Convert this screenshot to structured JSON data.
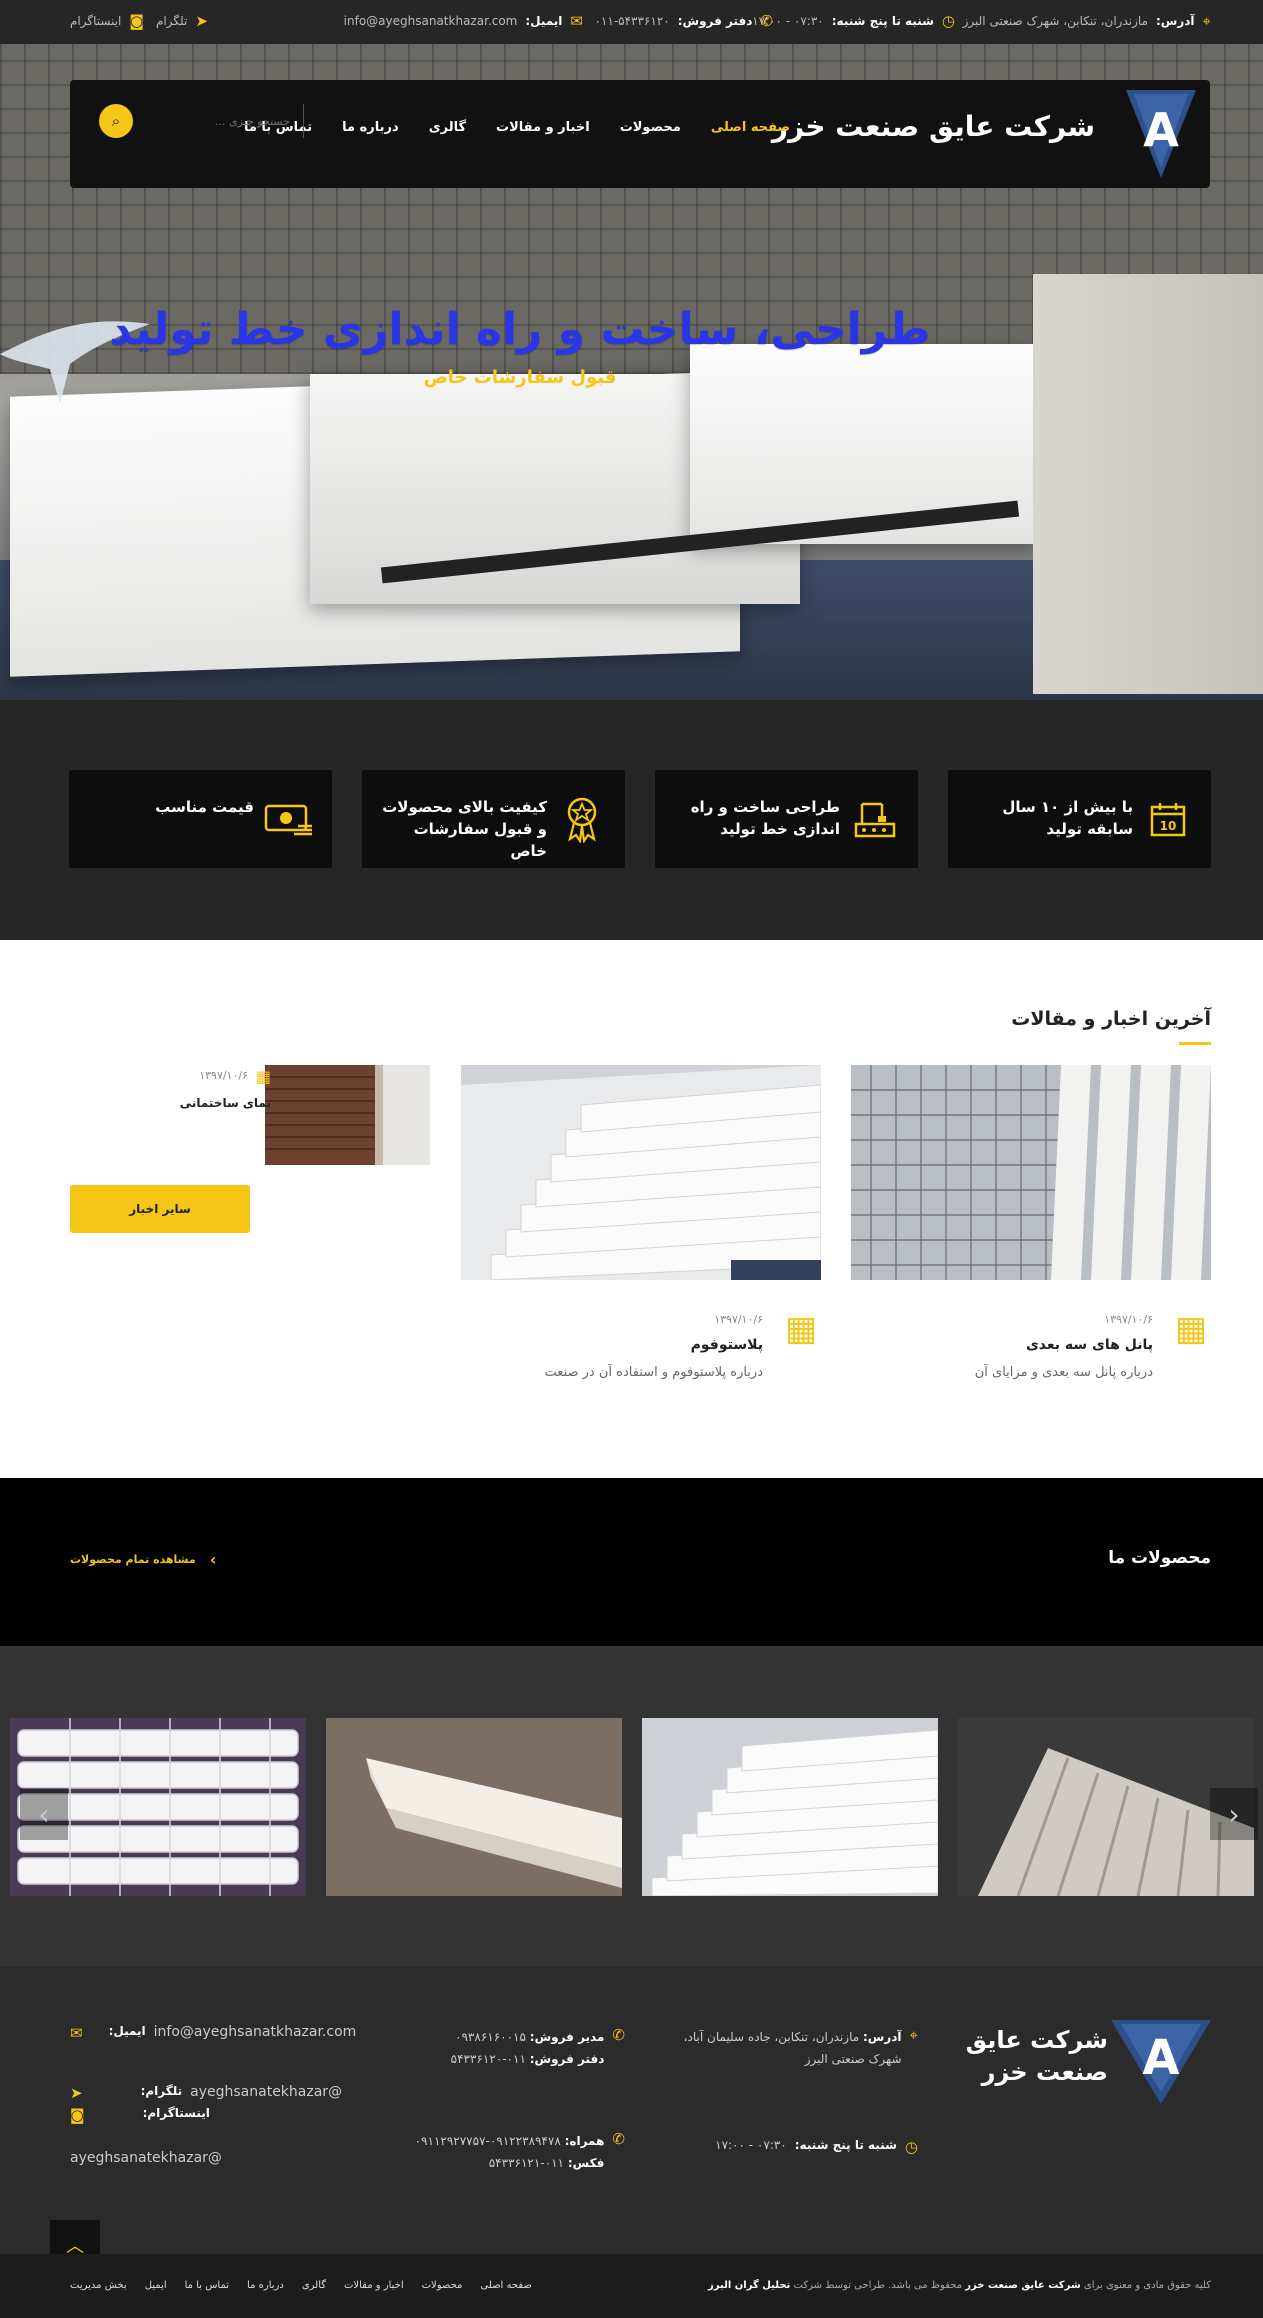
{
  "topbar": {
    "address_label": "آدرس:",
    "address_value": "مازندران، تنکابن، شهرک صنعتی البرز",
    "hours_label": "شنبه تا پنج شنبه:",
    "hours_value": "۰۷:۳۰ - ۱۷:۰۰",
    "sales_label": "دفتر فروش:",
    "sales_value": "۰۱۱-۵۴۳۳۶۱۲۰",
    "email_label": "ایمیل:",
    "email_value": "info@ayeghsanatkhazar.com",
    "telegram": "تلگرام",
    "instagram": "اینستاگرام"
  },
  "nav": {
    "brand": "شرکت عایق صنعت خزر",
    "logo_letter": "A",
    "items": [
      "صفحه اصلی",
      "محصولات",
      "اخبار و مقالات",
      "گالری",
      "درباره ما",
      "تماس با ما"
    ],
    "search_placeholder": "جستجو چیزی ..."
  },
  "hero": {
    "title": "طراحی، ساخت و راه اندازی خط تولید",
    "subtitle": "قبول سفارشات خاص"
  },
  "features": [
    {
      "text": "با بیش از ۱۰ سال سابقه تولید",
      "icon": "calendar-10-icon"
    },
    {
      "text": "طراحی ساخت و راه اندازی خط تولید",
      "icon": "production-line-icon"
    },
    {
      "text": "کیفیت بالای محصولات و قبول سفارشات خاص",
      "icon": "quality-badge-icon"
    },
    {
      "text": "قیمت مناسب",
      "icon": "money-icon"
    }
  ],
  "news": {
    "title": "آخرین اخبار و مقالات",
    "items": [
      {
        "date": "۱۳۹۷/۱۰/۶",
        "title": "پانل های سه بعدی",
        "desc": "درباره پانل سه بعدی و مزایای آن"
      },
      {
        "date": "۱۳۹۷/۱۰/۶",
        "title": "پلاستوفوم",
        "desc": "درباره پلاستوفوم و استفاده آن در صنعت"
      },
      {
        "date": "۱۳۹۷/۱۰/۶",
        "title": "نمای ساختمانی"
      }
    ],
    "more_label": "سایر اخبار"
  },
  "products": {
    "title": "محصولات ما",
    "view_all": "مشاهده تمام محصولات"
  },
  "footer": {
    "brand_line1": "شرکت عایق",
    "brand_line2": "صنعت خزر",
    "address_label": "آدرس:",
    "address_value_1": "مازندران، تنکابن، جاده سلیمان آباد،",
    "address_value_2": "شهرک صنعتی البرز",
    "hours_label": "شنبه تا پنج شنبه:",
    "hours_value": "۰۷:۳۰ - ۱۷:۰۰",
    "sales_manager_label": "مدیر فروش:",
    "sales_manager_value": "۰۹۳۸۶۱۶۰۰۱۵",
    "sales_office_label": "دفتر فروش:",
    "sales_office_value": "۰۱۱-۵۴۳۳۶۱۲۰",
    "mobile_label": "همراه:",
    "mobile_value": "۰۹۱۲۲۳۸۹۴۷۸-۰۹۱۱۲۹۲۷۷۵۷",
    "fax_label": "فکس:",
    "fax_value": "۰۱۱-۵۴۳۳۶۱۲۱",
    "email_label": "ایمیل:",
    "email_value": "info@ayeghsanatkhazar.com",
    "telegram_label": "تلگرام:",
    "telegram_value": "@ayeghsanatekhazar",
    "instagram_label": "اینستاگرام:",
    "instagram_value": "@ayeghsanatekhazar"
  },
  "copyright": {
    "prefix": "کلیه حقوق مادی و معنوی برای",
    "company": "شرکت عایق صنعت خزر",
    "middle": "محفوظ می باشد. طراحی توسط شرکت",
    "designer": "تحلیل گران البرز",
    "links": [
      "صفحه اصلی",
      "محصولات",
      "اخبار و مقالات",
      "گالری",
      "درباره ما",
      "تماس با ما",
      "ایمیل",
      "بخش مدیریت"
    ]
  },
  "colors": {
    "accent": "#f5c518",
    "hero_title": "#2a35e6",
    "dark": "#111111"
  }
}
